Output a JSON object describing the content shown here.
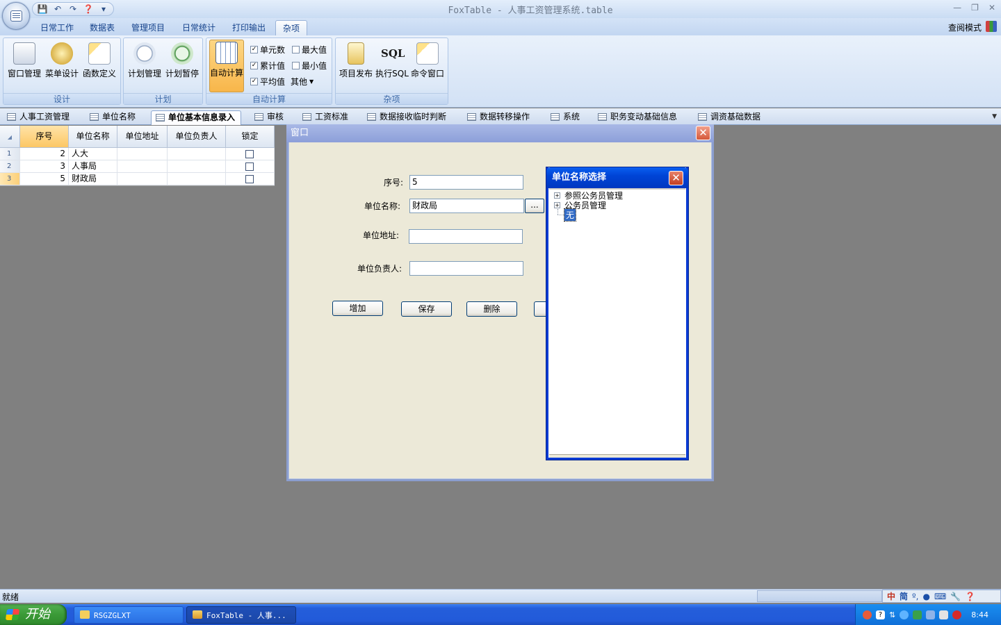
{
  "window": {
    "title": "FoxTable - 人事工资管理系统.table"
  },
  "qat": {
    "icons": [
      "save-icon",
      "undo-icon",
      "redo-icon",
      "help-icon",
      "dropdown-icon"
    ]
  },
  "ribbon": {
    "tabs": [
      {
        "label": "日常工作"
      },
      {
        "label": "数据表"
      },
      {
        "label": "管理项目"
      },
      {
        "label": "日常统计"
      },
      {
        "label": "打印输出"
      },
      {
        "label": "杂项"
      }
    ],
    "active_tab": "杂项",
    "view_mode": "查阅模式",
    "groups": {
      "design": {
        "label": "设计",
        "buttons": [
          {
            "label": "窗口管理"
          },
          {
            "label": "菜单设计"
          },
          {
            "label": "函数定义"
          }
        ]
      },
      "plan": {
        "label": "计划",
        "buttons": [
          {
            "label": "计划管理"
          },
          {
            "label": "计划暂停"
          }
        ]
      },
      "autocalc": {
        "label": "自动计算",
        "button": "自动计算",
        "checks": [
          {
            "label": "单元数",
            "checked": true
          },
          {
            "label": "累计值",
            "checked": true
          },
          {
            "label": "平均值",
            "checked": true
          },
          {
            "label": "最大值",
            "checked": false
          },
          {
            "label": "最小值",
            "checked": false
          }
        ],
        "other": "其他"
      },
      "misc": {
        "label": "杂项",
        "buttons": [
          {
            "label": "项目发布"
          },
          {
            "label": "执行SQL"
          },
          {
            "label": "命令窗口"
          }
        ],
        "sql_icon_text": "SQL"
      }
    }
  },
  "doc_tabs": [
    {
      "label": "人事工资管理"
    },
    {
      "label": "单位名称"
    },
    {
      "label": "单位基本信息录入"
    },
    {
      "label": "审核"
    },
    {
      "label": "工资标准"
    },
    {
      "label": "数据接收临时判断"
    },
    {
      "label": "数据转移操作"
    },
    {
      "label": "系统"
    },
    {
      "label": "职务变动基础信息"
    },
    {
      "label": "调资基础数据"
    }
  ],
  "grid": {
    "columns": [
      {
        "label": "序号"
      },
      {
        "label": "单位名称"
      },
      {
        "label": "单位地址"
      },
      {
        "label": "单位负责人"
      },
      {
        "label": "锁定"
      }
    ],
    "rows": [
      {
        "n": "1",
        "seq": "2",
        "name": "人大",
        "addr": "",
        "head": "",
        "locked": false
      },
      {
        "n": "2",
        "seq": "3",
        "name": "人事局",
        "addr": "",
        "head": "",
        "locked": false
      },
      {
        "n": "3",
        "seq": "5",
        "name": "财政局",
        "addr": "",
        "head": "",
        "locked": false
      }
    ]
  },
  "dialog": {
    "title": "窗口",
    "fields": {
      "seq": {
        "label": "序号:",
        "value": "5"
      },
      "name": {
        "label": "单位名称:",
        "value": "财政局",
        "browse": "..."
      },
      "addr": {
        "label": "单位地址:",
        "value": ""
      },
      "head": {
        "label": "单位负责人:",
        "value": ""
      }
    },
    "buttons": {
      "add": "增加",
      "save": "保存",
      "delete": "删除"
    }
  },
  "picker": {
    "title": "单位名称选择",
    "nodes": [
      {
        "label": "参照公务员管理"
      },
      {
        "label": "公务员管理"
      },
      {
        "label": "无"
      }
    ]
  },
  "status": {
    "text": "就绪"
  },
  "ime": {
    "chars": [
      "中",
      "简"
    ]
  },
  "taskbar": {
    "start": "开始",
    "tasks": [
      {
        "label": "RSGZGLXT"
      },
      {
        "label": "FoxTable - 人事..."
      }
    ],
    "clock": "8:44"
  }
}
